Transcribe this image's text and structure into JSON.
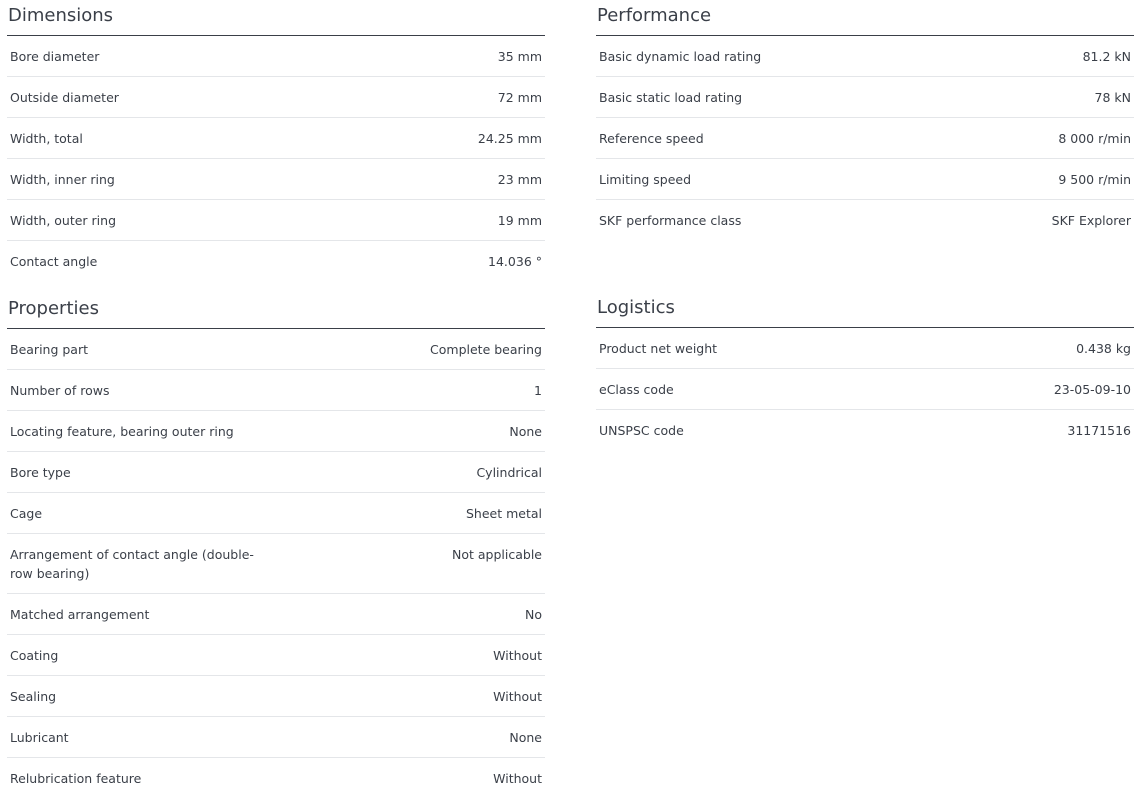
{
  "dimensions": {
    "title": "Dimensions",
    "rows": [
      {
        "label": "Bore diameter",
        "value": "35 mm"
      },
      {
        "label": "Outside diameter",
        "value": "72 mm"
      },
      {
        "label": "Width, total",
        "value": "24.25 mm"
      },
      {
        "label": "Width, inner ring",
        "value": "23 mm"
      },
      {
        "label": "Width, outer ring",
        "value": "19 mm"
      },
      {
        "label": "Contact angle",
        "value": "14.036 °"
      }
    ]
  },
  "properties": {
    "title": "Properties",
    "rows": [
      {
        "label": "Bearing part",
        "value": "Complete bearing"
      },
      {
        "label": "Number of rows",
        "value": "1"
      },
      {
        "label": "Locating feature, bearing outer ring",
        "value": "None"
      },
      {
        "label": "Bore type",
        "value": "Cylindrical"
      },
      {
        "label": "Cage",
        "value": "Sheet metal"
      },
      {
        "label": "Arrangement of contact angle (double-row bearing)",
        "value": "Not applicable"
      },
      {
        "label": "Matched arrangement",
        "value": "No"
      },
      {
        "label": "Coating",
        "value": "Without"
      },
      {
        "label": "Sealing",
        "value": "Without"
      },
      {
        "label": "Lubricant",
        "value": "None"
      },
      {
        "label": "Relubrication feature",
        "value": "Without"
      }
    ]
  },
  "performance": {
    "title": "Performance",
    "rows": [
      {
        "label": "Basic dynamic load rating",
        "value": "81.2 kN"
      },
      {
        "label": "Basic static load rating",
        "value": "78 kN"
      },
      {
        "label": "Reference speed",
        "value": "8 000 r/min"
      },
      {
        "label": "Limiting speed",
        "value": "9 500 r/min"
      },
      {
        "label": "SKF performance class",
        "value": "SKF Explorer"
      }
    ]
  },
  "logistics": {
    "title": "Logistics",
    "rows": [
      {
        "label": "Product net weight",
        "value": "0.438 kg"
      },
      {
        "label": "eClass code",
        "value": "23-05-09-10"
      },
      {
        "label": "UNSPSC code",
        "value": "31171516"
      }
    ]
  }
}
